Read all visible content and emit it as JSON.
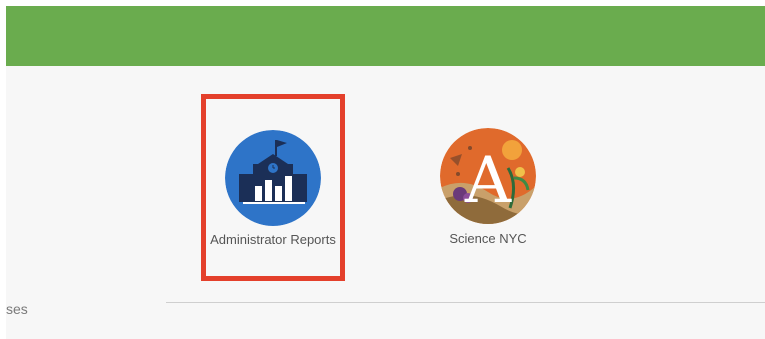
{
  "header": {
    "bar_color": "#6aac4e"
  },
  "apps": [
    {
      "label": "Administrator Reports",
      "icon": "school-reports-icon",
      "icon_color": "#2e74c8",
      "selected": true
    },
    {
      "label": "Science NYC",
      "icon": "science-nyc-logo-icon",
      "icon_letter": "A"
    }
  ],
  "sidebar": {
    "partial_label": "ses"
  },
  "colors": {
    "selection_border": "#e4402b",
    "content_background": "#f7f7f7"
  }
}
